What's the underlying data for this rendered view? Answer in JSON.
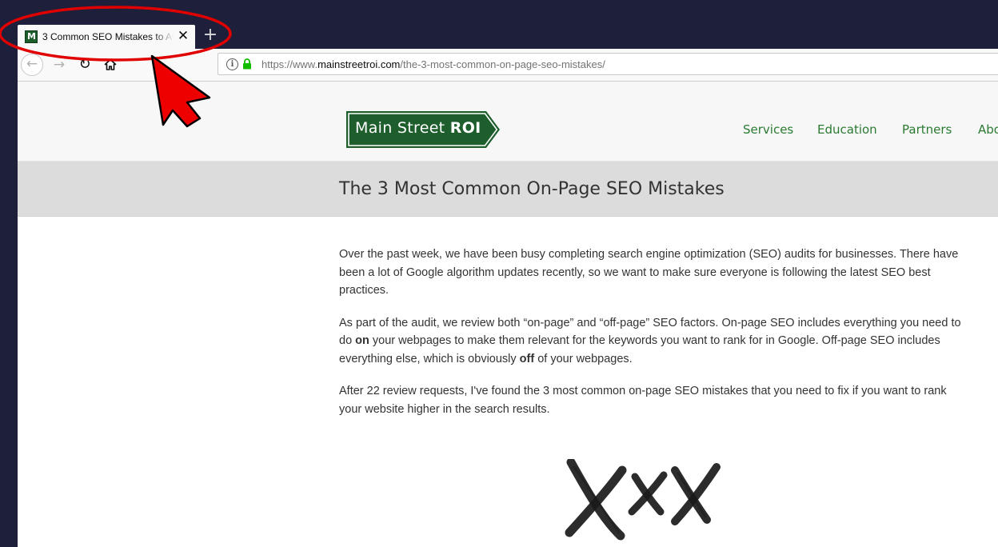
{
  "browser": {
    "tab": {
      "title": "3 Common SEO Mistakes to Av",
      "close_glyph": "✕",
      "favicon": "main-street-roi-favicon"
    },
    "new_tab_glyph": "+",
    "nav": {
      "back_glyph": "←",
      "forward_glyph": "→",
      "reload_glyph": "↻",
      "home_glyph": "⌂"
    },
    "url": {
      "scheme": "https://www.",
      "domain": "mainstreetroi.com",
      "path": "/the-3-most-common-on-page-seo-mistakes/"
    }
  },
  "site": {
    "logo": {
      "main": "Main Street ",
      "bold": "ROI"
    },
    "nav": {
      "services": "Services",
      "education": "Education",
      "partners": "Partners",
      "about": "Abo"
    }
  },
  "article": {
    "title": "The 3 Most Common On-Page SEO Mistakes",
    "p1": "Over the past week, we have been busy completing search engine optimization (SEO) audits for businesses.  There have been a lot of Google algorithm updates recently, so we want to make sure everyone is following the latest SEO best practices.",
    "p2": {
      "a": "As part of the audit, we review both “on-page” and “off-page” SEO factors.  On-page SEO includes everything you need to do ",
      "b": "on",
      "c": " your webpages to make them relevant for the keywords you want to rank for in Google.  Off-page SEO includes everything else, which is obviously ",
      "d": "off",
      "e": " of your webpages."
    },
    "p3": "After 22 review requests, I've found the 3 most common on-page SEO mistakes that you need to fix if you want to rank your website higher in the search results."
  },
  "colors": {
    "brand_green": "#1d5e2c",
    "nav_green": "#2a7a32",
    "annotation_red": "#e00000",
    "window_frame": "#1e1f3a"
  }
}
